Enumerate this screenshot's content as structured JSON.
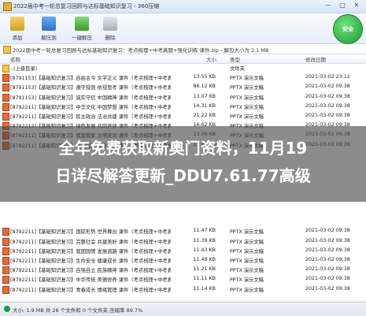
{
  "window": {
    "title": "2022届中考一轮总复习回顾与达标基础知识复习 - 360压缩",
    "minimize": "—",
    "maximize": "□",
    "close": "✕"
  },
  "toolbar": {
    "add": "添加",
    "extract": "解压到",
    "one_click": "一键解压",
    "delete": "删除",
    "security_label": "安全"
  },
  "path": {
    "text": "2022届中考一轮总复习回顾与达标基础知识复习：考点梳理+中考真题+强化训练 课件.zip - 解包大小为 2.1 MB"
  },
  "columns": {
    "name": "名称",
    "size": "大小",
    "type": "类型",
    "date": "修改日期"
  },
  "files": [
    {
      "name": "..(上级目录)",
      "size": "",
      "type": "文件夹",
      "date": ""
    },
    {
      "name": "[8791153]【基础知识复习】自由古今 文学正义 课件（考点梳理+中考真...",
      "size": "13.55 KB",
      "type": "PPTX 演示文稿",
      "date": "2021-03-02 23:11"
    },
    {
      "name": "[8791153]【基础知识复习】遵守规则 依规思考 课件（考点梳理+中考真...",
      "size": "86.12 KB",
      "type": "PPTX 演示文稿",
      "date": "2021-03-02 09:38"
    },
    {
      "name": "[8791153]【基础知识复习】诚实守信 中国精神 课件（考点梳理+中考真...",
      "size": "13.07 KB",
      "type": "PPTX 演示文稿",
      "date": "2021-03-02 09:38"
    },
    {
      "name": "[8792211]【基础知识复习】中华文化 中国梦想 课件（考点梳理+中考真...",
      "size": "14.31 KB",
      "type": "PPTX 演示文稿",
      "date": "2021-03-02 09:38"
    },
    {
      "name": "[8792211]【基础知识复习】民主政治 法治共建 课件（考点梳理+中考真...",
      "size": "21.22 KB",
      "type": "PPTX 演示文稿",
      "date": "2021-03-02 09:38"
    },
    {
      "name": "[8792212]【基础知识复习】绿色发展 共同开放 课件（考点梳理+中考真...",
      "size": "16.62 KB",
      "type": "PPTX 演示文稿",
      "date": "2021-03-02 09:38"
    },
    {
      "name": "[8792211]【基础知识复习】我爱我家 文明家风 课件（考点梳理+中考真...",
      "size": "13.06 KB",
      "type": "PPTX 演示文稿",
      "date": "2021-03-02 09:38"
    },
    {
      "name": "[8792211]【基础知识复习】维护国家 安全守护 课件（考点梳理+中考真...",
      "size": "11.40 KB",
      "type": "PPTX 演示文稿",
      "date": "2021-03-02 09:38"
    },
    {
      "name": "",
      "size": "",
      "type": "",
      "date": ""
    },
    {
      "name": "",
      "size": "",
      "type": "",
      "date": ""
    },
    {
      "name": "",
      "size": "",
      "type": "",
      "date": ""
    },
    {
      "name": "",
      "size": "",
      "type": "",
      "date": ""
    },
    {
      "name": "",
      "size": "",
      "type": "",
      "date": ""
    },
    {
      "name": "",
      "size": "",
      "type": "",
      "date": ""
    },
    {
      "name": "",
      "size": "",
      "type": "",
      "date": ""
    },
    {
      "name": "",
      "size": "",
      "type": "",
      "date": ""
    },
    {
      "name": "[8792211]【基础知识复习】国际形势 世界舞台 课件（考点梳理+中考真...",
      "size": "11.47 KB",
      "type": "PPTX 演示文稿",
      "date": "2021-03-02 09:38"
    },
    {
      "name": "[8792211]【基础知识复习】完整社会 共建美好 课件（考点梳理+中考真...",
      "size": "11.39 KB",
      "type": "PPTX 演示文稿",
      "date": "2021-03-02 09:38"
    },
    {
      "name": "[8792211]【基础知识复习】我国国情 发展道路 课件（考点梳理+中考真...",
      "size": "11.43 KB",
      "type": "PPTX 演示文稿",
      "date": "2021-03-02 09:38"
    },
    {
      "name": "[8792211]【基础知识复习】生命安全 健康成长 课件（考点梳理+中考真...",
      "size": "11.49 KB",
      "type": "PPTX 演示文稿",
      "date": "2021-03-02 09:38"
    },
    {
      "name": "[8792211]【基础知识复习】自强自立 民族精神 课件（考点梳理+中考真...",
      "size": "11.21 KB",
      "type": "PPTX 演示文稿",
      "date": "2021-03-02 09:38"
    },
    {
      "name": "[8792211]【基础知识复习】中华传统 美德修养 课件（考点梳理+中考真...",
      "size": "11.11 KB",
      "type": "PPTX 演示文稿",
      "date": "2021-03-02 09:38"
    },
    {
      "name": "[8792211]【基础知识复习】青春成长 情绪管理 课件（考点梳理+中考真...",
      "size": "11.14 KB",
      "type": "PPTX 演示文稿",
      "date": "2021-03-02 09:38"
    }
  ],
  "banner": {
    "line1": "全年免费获取新奥门资料，11月19",
    "line2": "日详尽解答更新_DDU7.61.77高级"
  },
  "status": {
    "text": "大小: 1.9 MB 共 28 个文件和 0 个文件夹 压缩率 89.7%"
  }
}
